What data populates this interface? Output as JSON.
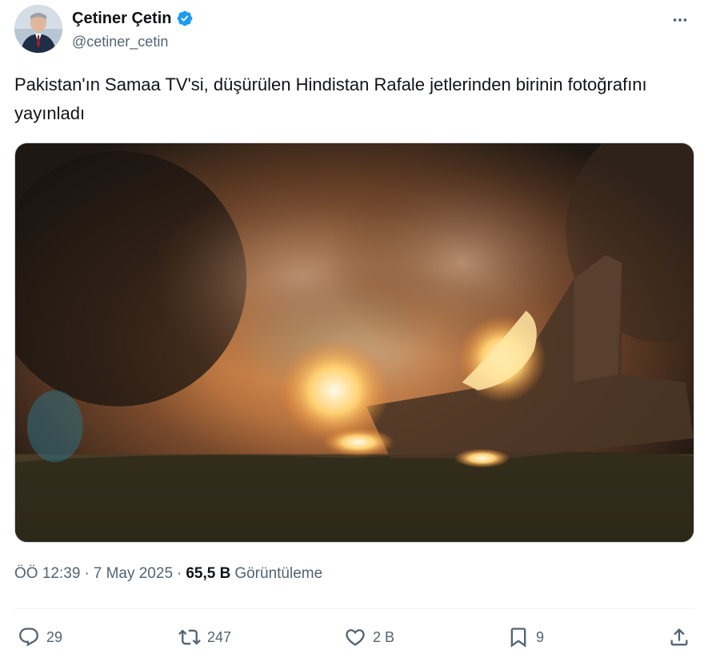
{
  "author": {
    "display_name": "Çetiner Çetin",
    "handle": "@cetiner_cetin",
    "verified": true
  },
  "tweet": {
    "text": "Pakistan'ın Samaa TV'si, düşürülen Hindistan Rafale jetlerinden birinin fotoğrafını yayınladı"
  },
  "meta": {
    "time": "ÖÖ 12:39",
    "separator1": "·",
    "date": "7 May 2025",
    "separator2": "·",
    "views_count": "65,5 B",
    "views_label": "Görüntüleme"
  },
  "actions": {
    "replies": "29",
    "reposts": "247",
    "likes": "2 B",
    "bookmarks": "9"
  },
  "colors": {
    "accent": "#1d9bf0",
    "secondary_text": "#536471",
    "primary_text": "#0f1419"
  },
  "icons": {
    "verified": "verified-badge-icon",
    "more": "more-icon",
    "reply": "reply-icon",
    "repost": "repost-icon",
    "like": "heart-icon",
    "bookmark": "bookmark-icon",
    "share": "share-icon"
  }
}
